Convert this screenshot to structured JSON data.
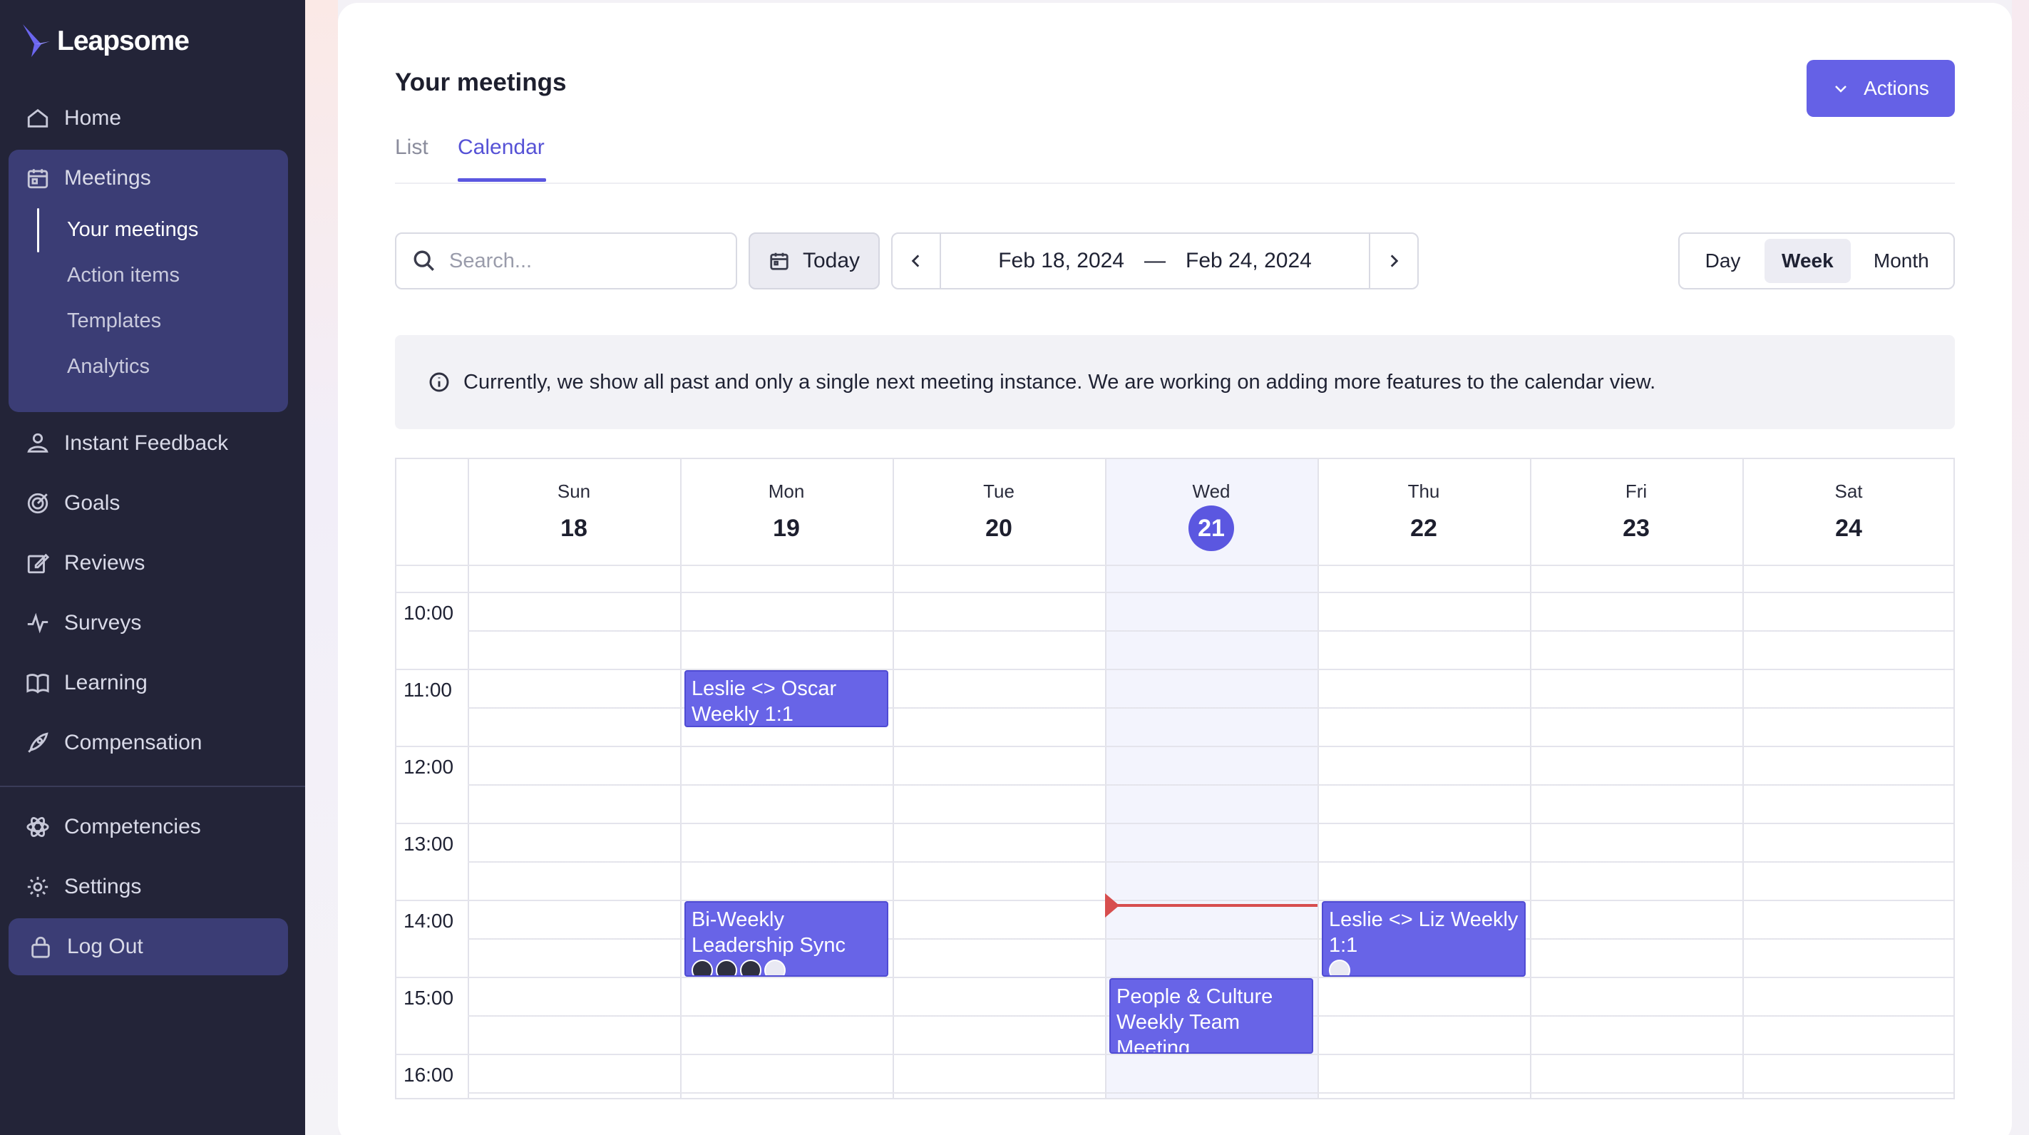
{
  "app": {
    "name": "Leapsome"
  },
  "sidebar": {
    "items": [
      {
        "label": "Home",
        "icon": "home-icon"
      },
      {
        "label": "Meetings",
        "icon": "calendar-icon"
      },
      {
        "label": "Instant Feedback",
        "icon": "feedback-icon"
      },
      {
        "label": "Goals",
        "icon": "target-icon"
      },
      {
        "label": "Reviews",
        "icon": "edit-icon"
      },
      {
        "label": "Surveys",
        "icon": "pulse-icon"
      },
      {
        "label": "Learning",
        "icon": "book-icon"
      },
      {
        "label": "Compensation",
        "icon": "rocket-icon"
      },
      {
        "label": "Competencies",
        "icon": "atom-icon"
      },
      {
        "label": "Settings",
        "icon": "gear-icon"
      }
    ],
    "meetings_sub": [
      {
        "label": "Your meetings",
        "active": true
      },
      {
        "label": "Action items"
      },
      {
        "label": "Templates"
      },
      {
        "label": "Analytics"
      }
    ],
    "logout": "Log Out"
  },
  "main": {
    "title": "Your meetings",
    "tabs": [
      {
        "label": "List"
      },
      {
        "label": "Calendar",
        "active": true
      }
    ],
    "actions_label": "Actions",
    "search": {
      "placeholder": "Search...",
      "value": ""
    },
    "today_label": "Today",
    "range": {
      "start": "Feb 18, 2024",
      "separator": "—",
      "end": "Feb 24, 2024"
    },
    "views": [
      {
        "label": "Day"
      },
      {
        "label": "Week",
        "active": true
      },
      {
        "label": "Month"
      }
    ],
    "info_text": "Currently, we show all past and only a single next meeting instance. We are working on adding more features to the calendar view."
  },
  "calendar": {
    "days": [
      {
        "name": "Sun",
        "num": "18"
      },
      {
        "name": "Mon",
        "num": "19"
      },
      {
        "name": "Tue",
        "num": "20"
      },
      {
        "name": "Wed",
        "num": "21",
        "today": true
      },
      {
        "name": "Thu",
        "num": "22"
      },
      {
        "name": "Fri",
        "num": "23"
      },
      {
        "name": "Sat",
        "num": "24"
      }
    ],
    "times": [
      "10:00",
      "11:00",
      "12:00",
      "13:00",
      "14:00",
      "15:00",
      "16:00"
    ],
    "events": [
      {
        "title": "Leslie <> Oscar Weekly 1:1",
        "day": "Mon",
        "start": "11:00",
        "end": "11:45"
      },
      {
        "title": "Bi-Weekly Leadership Sync",
        "day": "Mon",
        "start": "14:00",
        "end": "15:00",
        "attendee_avatars": 4
      },
      {
        "title": "Leslie <> Liz Weekly 1:1",
        "day": "Thu",
        "start": "14:00",
        "end": "15:00",
        "attendee_avatars": 1
      },
      {
        "title": "People & Culture Weekly Team Meeting",
        "day": "Wed",
        "start": "15:00",
        "end": "16:00"
      }
    ],
    "current_time": "14:05"
  },
  "colors": {
    "accent": "#5b57e0",
    "sidebar_bg": "#232438",
    "event_bg": "#6864e7",
    "now_line": "#d74e4e"
  }
}
